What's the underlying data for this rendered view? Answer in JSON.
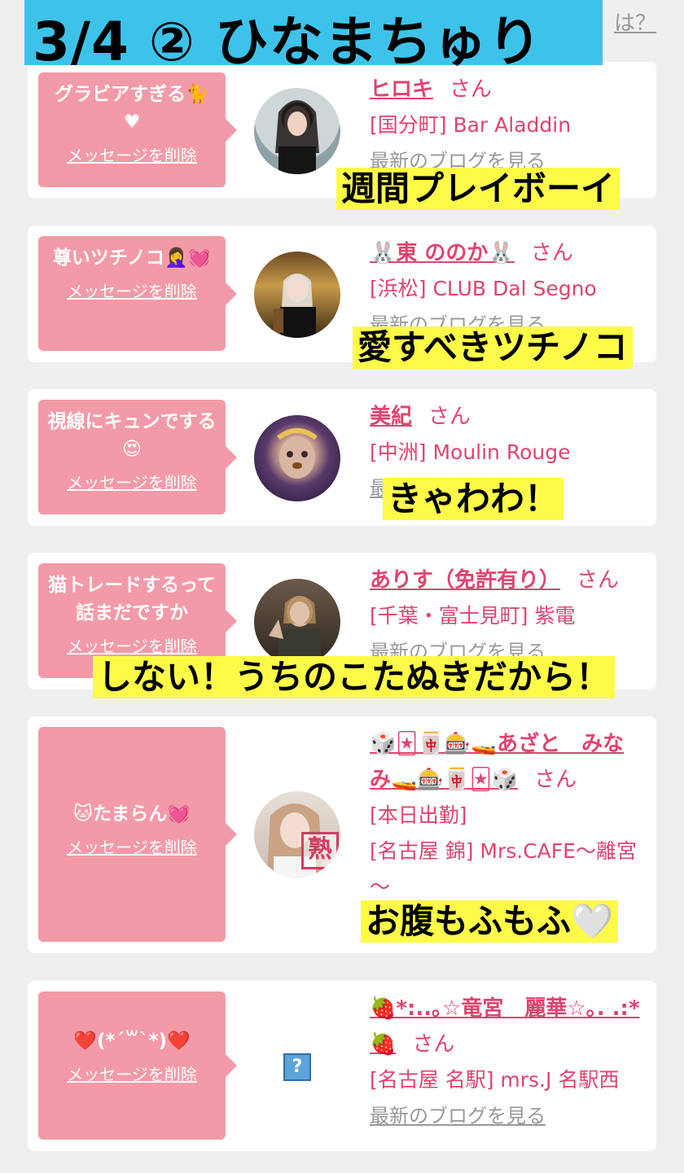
{
  "header": {
    "title": "3/4 ② ひなまちゅり",
    "partial_link": "は？"
  },
  "cards": [
    {
      "message": "グラビアすぎる🐈♥",
      "delete_label": "メッセージを削除",
      "name": "ヒロキ",
      "san": "さん",
      "shop": "[国分町] Bar Aladdin",
      "blog_label": "最新のブログを見る",
      "caption": "週間プレイボーイ"
    },
    {
      "message": "尊いツチノコ🤦‍♀️💓",
      "delete_label": "メッセージを削除",
      "name": "🐰東 ののか🐰",
      "san": "さん",
      "shop": "[浜松] CLUB Dal Segno",
      "blog_label": "最新のブログを見る",
      "caption": "愛すべきツチノコ"
    },
    {
      "message": "視線にキュンでする😍",
      "delete_label": "メッセージを削除",
      "name": "美紀",
      "san": "さん",
      "shop": "[中洲] Moulin Rouge",
      "blog_label": "最",
      "caption": "きゃわわ！"
    },
    {
      "message": "猫トレードするって話まだですか",
      "delete_label": "メッセージを削除",
      "name": "ありす（免許有り）",
      "san": "さん",
      "shop": "[千葉・富士見町] 紫電",
      "blog_label": "最新のブログを見る",
      "caption": "しない！うちのこたぬきだから！"
    },
    {
      "message": "🐱たまらん💓",
      "delete_label": "メッセージを削除",
      "name": "🎲🃏🀄🎰🚤あざと　みなみ🚤🎰🀄🃏🎲",
      "san": "さん",
      "status": "[本日出勤]",
      "shop": "[名古屋 錦] Mrs.CAFE～離宮～",
      "avatar_badge": "熟",
      "caption": "お腹もふもふ🤍"
    },
    {
      "message": "❤️(*´꒳`*)❤️",
      "delete_label": "メッセージを削除",
      "name": "🍓*:..｡☆竜宮　麗華☆｡. .:*🍓",
      "san": "さん",
      "shop": "[名古屋 名駅] mrs.J 名駅西",
      "blog_label": "最新のブログを見る",
      "avatar_placeholder": "?"
    }
  ],
  "colors": {
    "banner": "#3dc3ea",
    "bubble": "#f39aa8",
    "name": "#e0446e",
    "caption_bg": "#fdfb48"
  }
}
